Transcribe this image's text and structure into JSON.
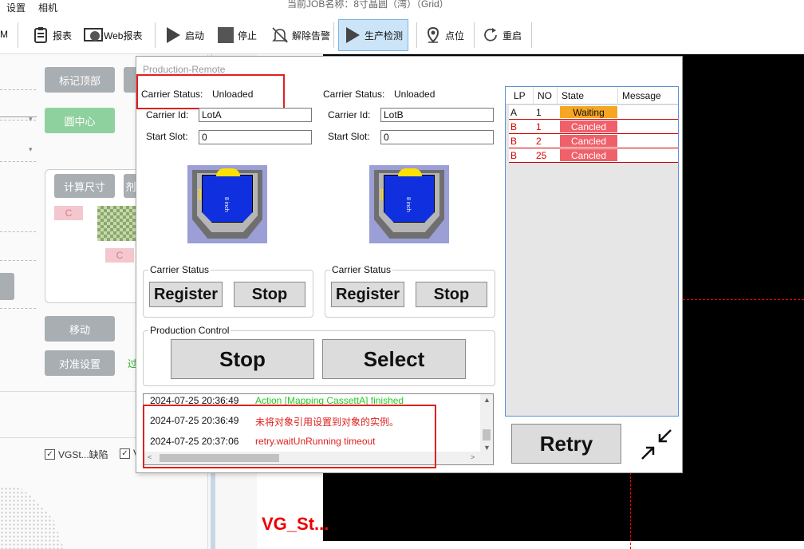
{
  "menubar": {
    "menu1": "设置",
    "menu2": "相机",
    "window_title": "当前JOB名称：8寸晶圆（湾）（Grid）"
  },
  "toolbar": {
    "m_label": "M",
    "items": [
      {
        "label": "报表"
      },
      {
        "label": "Web报表"
      },
      {
        "label": "启动"
      },
      {
        "label": "停止"
      },
      {
        "label": "解除告警"
      },
      {
        "label": "生产检测"
      },
      {
        "label": "点位"
      },
      {
        "label": "重启"
      }
    ]
  },
  "left": {
    "btn_mark_top": "标记顶部",
    "btn_circle_center": "圆中心",
    "btn_calc_size": "计算尺寸",
    "btn_calc_size_partial": "剂",
    "pink_c1": "C",
    "pink_c2": "C",
    "btn_move": "移动",
    "btn_align": "对准设置",
    "green_text": "过",
    "check1": "VGSt...缺陷",
    "check2": "V"
  },
  "canvas": {
    "vg_text": "VG_St..."
  },
  "dialog": {
    "title": "Production-Remote",
    "left": {
      "status_label": "Carrier Status:",
      "status_value": "Unloaded",
      "id_label": "Carrier Id:",
      "id_value": "LotA",
      "slot_label": "Start Slot:",
      "slot_value": "0",
      "img_text": "8 inch",
      "group_title": "Carrier Status",
      "register": "Register",
      "stop": "Stop"
    },
    "right": {
      "status_label": "Carrier Status:",
      "status_value": "Unloaded",
      "id_label": "Carrier Id:",
      "id_value": "LotB",
      "slot_label": "Start Slot:",
      "slot_value": "0",
      "img_text": "8 inch",
      "group_title": "Carrier Status",
      "register": "Register",
      "stop": "Stop"
    },
    "production": {
      "group_title": "Production Control",
      "stop": "Stop",
      "select": "Select"
    },
    "table": {
      "headers": [
        "LP",
        "NO",
        "State",
        "Message"
      ],
      "rows": [
        {
          "lp": "A",
          "no": "1",
          "state": "Waiting",
          "message": ""
        },
        {
          "lp": "B",
          "no": "1",
          "state": "Cancled",
          "message": ""
        },
        {
          "lp": "B",
          "no": "2",
          "state": "Cancled",
          "message": ""
        },
        {
          "lp": "B",
          "no": "25",
          "state": "Cancled",
          "message": ""
        }
      ]
    },
    "log": [
      {
        "time": "2024-07-25 20:36:49",
        "msg": "Action [Mapping CassettA] finished"
      },
      {
        "time": "2024-07-25 20:36:49",
        "msg": "未将对象引用设置到对象的实例。"
      },
      {
        "time": "2024-07-25 20:37:06",
        "msg": "retry.waitUnRunning timeout"
      }
    ],
    "retry": "Retry"
  },
  "colors": {
    "waiting": "#f5a623",
    "cancled": "#f0606a",
    "error_text": "#e02020",
    "ok_text": "#22cc22",
    "highlight": "#e02020"
  }
}
